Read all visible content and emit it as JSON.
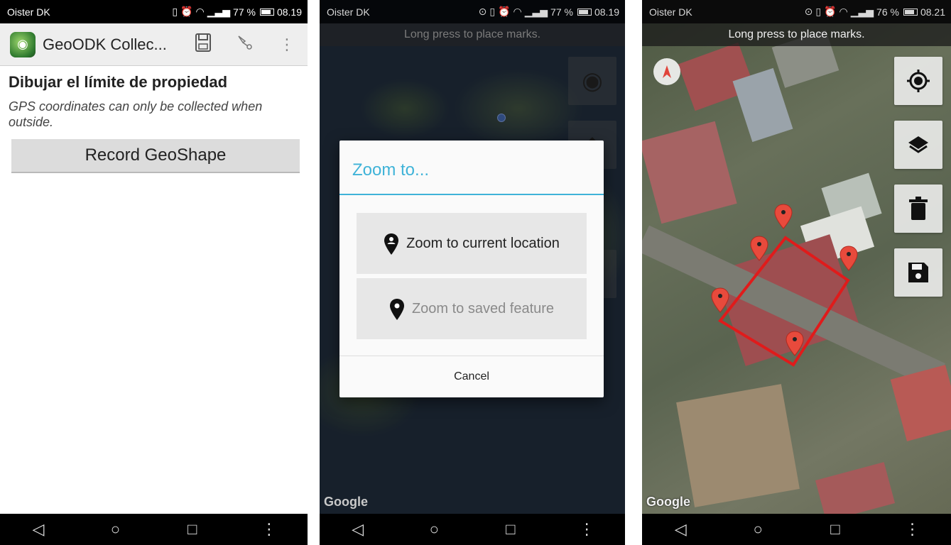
{
  "status": {
    "carrier": "Oister DK",
    "battery_p1": "77 %",
    "time_p1": "08.19",
    "battery_p2": "77 %",
    "time_p2": "08.19",
    "battery_p3": "76 %",
    "time_p3": "08.21"
  },
  "appbar": {
    "title": "GeoODK Collec..."
  },
  "form": {
    "question_title": "Dibujar el límite de propiedad",
    "question_hint": "GPS coordinates can only be collected when outside.",
    "record_label": "Record GeoShape"
  },
  "map": {
    "hint": "Long press to place marks.",
    "attribution": "Google"
  },
  "dialog": {
    "title": "Zoom to...",
    "current_label": "Zoom to current location",
    "saved_label": "Zoom to saved feature",
    "cancel_label": "Cancel"
  },
  "nav": {
    "back": "◁",
    "home": "○",
    "recents": "□",
    "menu": "⋮"
  },
  "icons": {
    "appbar": [
      "save-icon",
      "layer-select-icon",
      "overflow-menu-icon"
    ],
    "map_tools": [
      "gps-location-icon",
      "layers-icon",
      "trash-icon",
      "save-icon"
    ]
  },
  "colors": {
    "accent": "#3fb3d8",
    "shape": "#e01b1b",
    "marker": "#e84a3c"
  }
}
